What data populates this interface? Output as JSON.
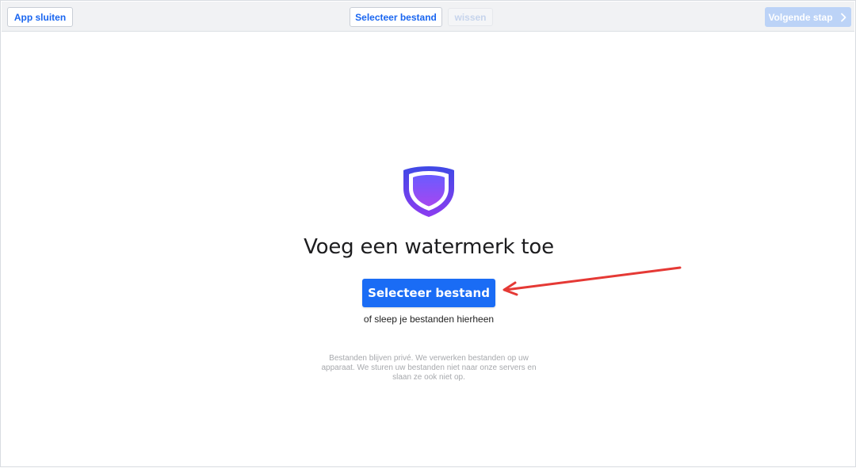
{
  "toolbar": {
    "close_app_label": "App sluiten",
    "select_file_label": "Selecteer bestand",
    "clear_label": "wissen",
    "next_step_label": "Volgende stap",
    "next_step_icon": "chevron-right-icon"
  },
  "main": {
    "logo_icon": "shield-icon",
    "title": "Voeg een watermerk toe",
    "select_button_label": "Selecteer bestand",
    "drop_hint": "of sleep je bestanden hierheen",
    "privacy_note": "Bestanden blijven privé. We verwerken bestanden op uw apparaat. We sturen uw bestanden niet naar onze servers en slaan ze ook niet op."
  },
  "colors": {
    "primary": "#1a6cf5",
    "shield_outer": "#4b3fe0",
    "shield_inner_top": "#6a5cff",
    "shield_inner_bottom": "#a646f0",
    "annotation_arrow": "#e53935"
  }
}
